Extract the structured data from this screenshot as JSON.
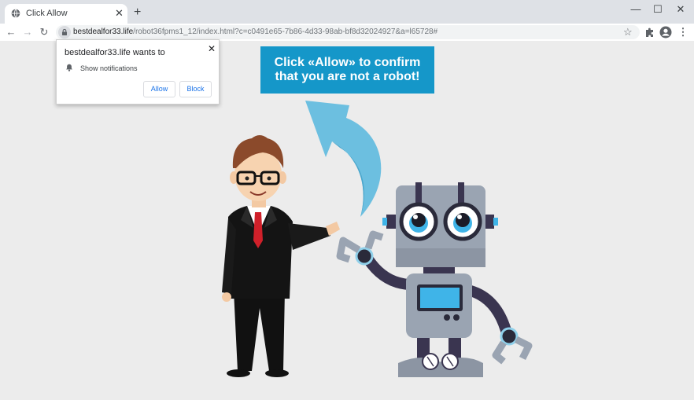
{
  "browser": {
    "tab": {
      "title": "Click Allow",
      "favicon": "globe-icon",
      "close_glyph": "✕"
    },
    "new_tab_glyph": "+",
    "window_controls": {
      "minimize": "—",
      "maximize": "☐",
      "close": "✕"
    },
    "toolbar": {
      "back_glyph": "←",
      "forward_glyph": "→",
      "reload_glyph": "↻",
      "url_host": "bestdealfor33.life",
      "url_path": "/robot36fpms1_12/index.html?c=c0491e65-7b86-4d33-98ab-bf8d32024927&a=l65728#",
      "bookmark_glyph": "☆",
      "menu_glyph": "⋮"
    }
  },
  "permission_prompt": {
    "title": "bestdealfor33.life wants to",
    "permission": "Show notifications",
    "allow_label": "Allow",
    "block_label": "Block",
    "close_glyph": "✕"
  },
  "page": {
    "banner_line1": "Click «Allow» to confirm",
    "banner_line2": "that you are not a robot!",
    "colors": {
      "banner": "#1597c9",
      "arrow": "#6cbfe0",
      "robot_body": "#9aa4b2",
      "suit": "#111111",
      "tie": "#d0202a"
    }
  }
}
